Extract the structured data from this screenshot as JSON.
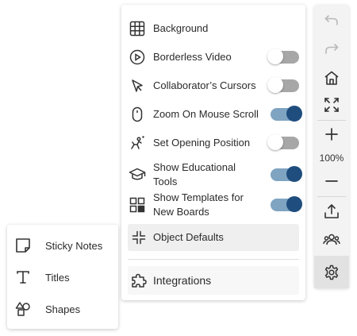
{
  "settings": {
    "items": [
      {
        "label": "Background",
        "icon": "grid-icon"
      },
      {
        "label": "Borderless Video",
        "icon": "play-circle-icon",
        "toggle": false
      },
      {
        "label": "Collaborator’s Cursors",
        "icon": "cursor-icon",
        "toggle": false
      },
      {
        "label": "Zoom On Mouse Scroll",
        "icon": "mouse-icon",
        "toggle": true
      },
      {
        "label": "Set Opening Position",
        "icon": "position-icon",
        "toggle": false
      },
      {
        "label": "Show Educational Tools",
        "icon": "graduation-cap-icon",
        "toggle": true
      },
      {
        "label": "Show Templates for New Boards",
        "icon": "templates-icon",
        "toggle": true
      }
    ],
    "object_defaults": "Object Defaults",
    "integrations": "Integrations"
  },
  "toolbar": {
    "zoom": "100%",
    "buttons": [
      "undo-icon",
      "redo-icon",
      "home-icon",
      "fit-screen-icon",
      "zoom-in-icon",
      "zoom-out-icon",
      "export-icon",
      "collaborators-icon",
      "settings-gear-icon"
    ]
  },
  "insert": {
    "items": [
      {
        "label": "Sticky Notes",
        "icon": "sticky-note-icon"
      },
      {
        "label": "Titles",
        "icon": "text-icon"
      },
      {
        "label": "Shapes",
        "icon": "shapes-icon"
      }
    ]
  },
  "colors": {
    "toggle_on_track": "#7fa4c2",
    "toggle_on_knob": "#1f4e7e",
    "toggle_off_track": "#a7a7a7"
  }
}
